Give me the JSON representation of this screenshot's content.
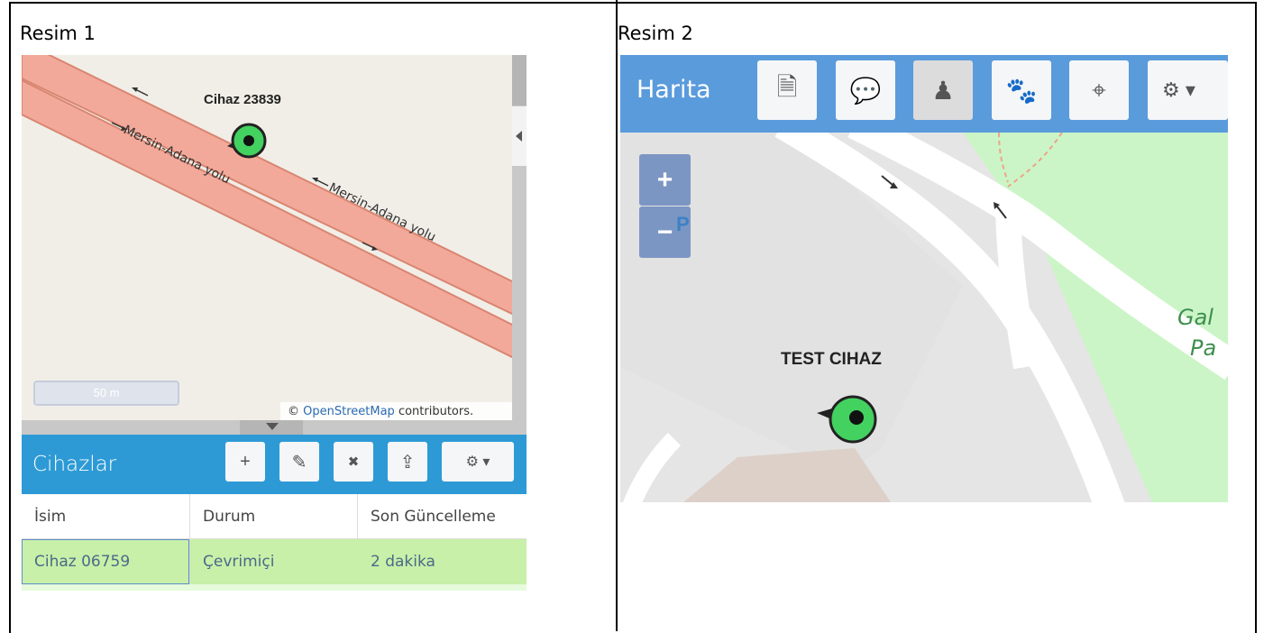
{
  "panels": {
    "left": {
      "caption": "Resim 1",
      "map": {
        "device_label": "Cihaz 23839",
        "road_labels": [
          "Mersin-Adana yolu",
          "Mersin-Adana yolu"
        ],
        "scale": "50 m",
        "attribution_prefix": "© ",
        "attribution_link": "OpenStreetMap",
        "attribution_suffix": " contributors."
      },
      "devices": {
        "title": "Cihazlar",
        "toolbar": [
          {
            "icon": "plus-icon",
            "glyph": "+"
          },
          {
            "icon": "pencil-icon",
            "glyph": "✎"
          },
          {
            "icon": "close-icon",
            "glyph": "✖"
          },
          {
            "icon": "upload-icon",
            "glyph": "⇪"
          },
          {
            "icon": "gear-icon",
            "glyph": "⚙ ▾"
          }
        ],
        "columns": [
          "İsim",
          "Durum",
          "Son Güncelleme"
        ],
        "rows": [
          {
            "name": "Cihaz 06759",
            "status": "Çevrimiçi",
            "last_update": "2 dakika"
          }
        ]
      }
    },
    "right": {
      "caption": "Resim 2",
      "map_bar": {
        "title": "Harita",
        "buttons": [
          {
            "icon": "document-icon",
            "glyph": "🗎"
          },
          {
            "icon": "chat-icon",
            "glyph": "💬"
          },
          {
            "icon": "person-icon",
            "glyph": "♟"
          },
          {
            "icon": "paw-icon",
            "glyph": "🐾"
          },
          {
            "icon": "crosshair-icon",
            "glyph": "⌖"
          },
          {
            "icon": "gear-icon",
            "glyph": "⚙ ▾"
          }
        ]
      },
      "zoom": {
        "in": "+",
        "out": "−"
      },
      "parking_glyph": "P",
      "device_label": "TEST CIHAZ",
      "park_labels": [
        "Gal",
        "Pa"
      ]
    }
  },
  "colors": {
    "devices_bar": "#2d9ad6",
    "map_bar": "#5a9bdc",
    "road_fill": "#f3a99a",
    "road_stroke": "#d98670",
    "marker": "#43d160",
    "selected_row": "#c8f0a8",
    "park": "#cbf5c6"
  }
}
